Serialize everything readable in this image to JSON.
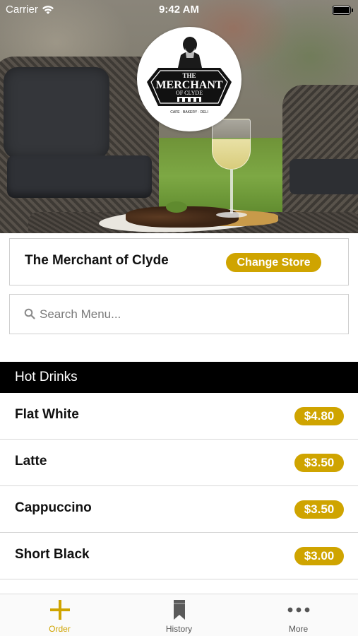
{
  "status_bar": {
    "carrier": "Carrier",
    "time": "9:42 AM"
  },
  "logo": {
    "line1": "THE",
    "line2": "MERCHANT",
    "line3": "OF CLYDE",
    "tagline": "CAFE · BAKERY · DELI"
  },
  "store": {
    "name": "The Merchant of Clyde",
    "change_label": "Change Store"
  },
  "search": {
    "placeholder": "Search Menu..."
  },
  "section": {
    "title": "Hot Drinks"
  },
  "menu": [
    {
      "name": "Flat White",
      "price": "$4.80"
    },
    {
      "name": "Latte",
      "price": "$3.50"
    },
    {
      "name": "Cappuccino",
      "price": "$3.50"
    },
    {
      "name": "Short Black",
      "price": "$3.00"
    }
  ],
  "tabs": [
    {
      "label": "Order",
      "icon": "plus-icon",
      "active": true
    },
    {
      "label": "History",
      "icon": "bookmark-icon",
      "active": false
    },
    {
      "label": "More",
      "icon": "more-dots-icon",
      "active": false
    }
  ],
  "colors": {
    "accent": "#cfa400",
    "section_bg": "#000000"
  }
}
